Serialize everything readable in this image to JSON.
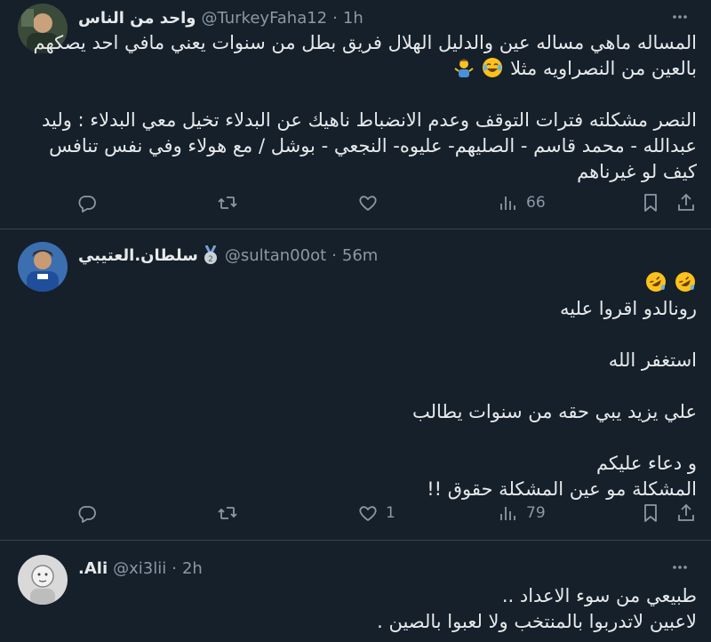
{
  "tweets": [
    {
      "display_name": "واحد من الناس",
      "handle": "@TurkeyFaha12",
      "time": "1h",
      "body_lines": [
        "المساله ماهي مساله عين والدليل الهلال فريق بطل من سنوات يعني مافي احد يصكهم",
        "بالعين من النصراويه مثلا",
        "",
        "النصر مشكلته فترات التوقف وعدم الانضباط ناهيك عن البدلاء تخيل معي البدلاء : وليد",
        "عبدالله - محمد قاسم - الصليهم- عليوه- النجعي - بوشل / مع هولاء وفي نفس تنافس",
        "كيف لو غيرناهم"
      ],
      "stats": {
        "replies": "",
        "retweets": "",
        "likes": "",
        "views": "66"
      }
    },
    {
      "display_name": "سلطان.العتيبي",
      "handle": "@sultan00ot",
      "time": "56m",
      "body_lines": [
        "",
        "رونالدو اقروا عليه",
        "",
        "استغفر الله",
        "",
        "علي يزيد يبي حقه من سنوات يطالب",
        "",
        "و دعاء عليكم",
        "المشكلة مو عين  المشكلة حقوق !!"
      ],
      "stats": {
        "replies": "",
        "retweets": "",
        "likes": "1",
        "views": "79"
      }
    },
    {
      "display_name": "Ali.",
      "handle": "@xi3lii",
      "time": "2h",
      "body_lines": [
        "طبيعي من سوء الاعداد ..",
        "لاعبين لاتدربوا بالمنتخب ولا لعبوا بالصين ."
      ]
    }
  ],
  "icons": {
    "more": "more-horizontal-icon",
    "reply": "reply-icon",
    "retweet": "retweet-icon",
    "like": "heart-icon",
    "views": "views-chart-icon",
    "bookmark": "bookmark-icon",
    "share": "share-icon",
    "laugh_emoji": "face-with-tears-of-joy-emoji",
    "rofl_emoji": "rolling-on-floor-laughing-emoji",
    "shrug_emoji": "person-shrugging-emoji",
    "medal_badge": "medal-badge-icon"
  },
  "colors": {
    "background": "#15202b",
    "text": "#e7e9ea",
    "muted": "#8b98a5",
    "separator": "#38444d"
  }
}
